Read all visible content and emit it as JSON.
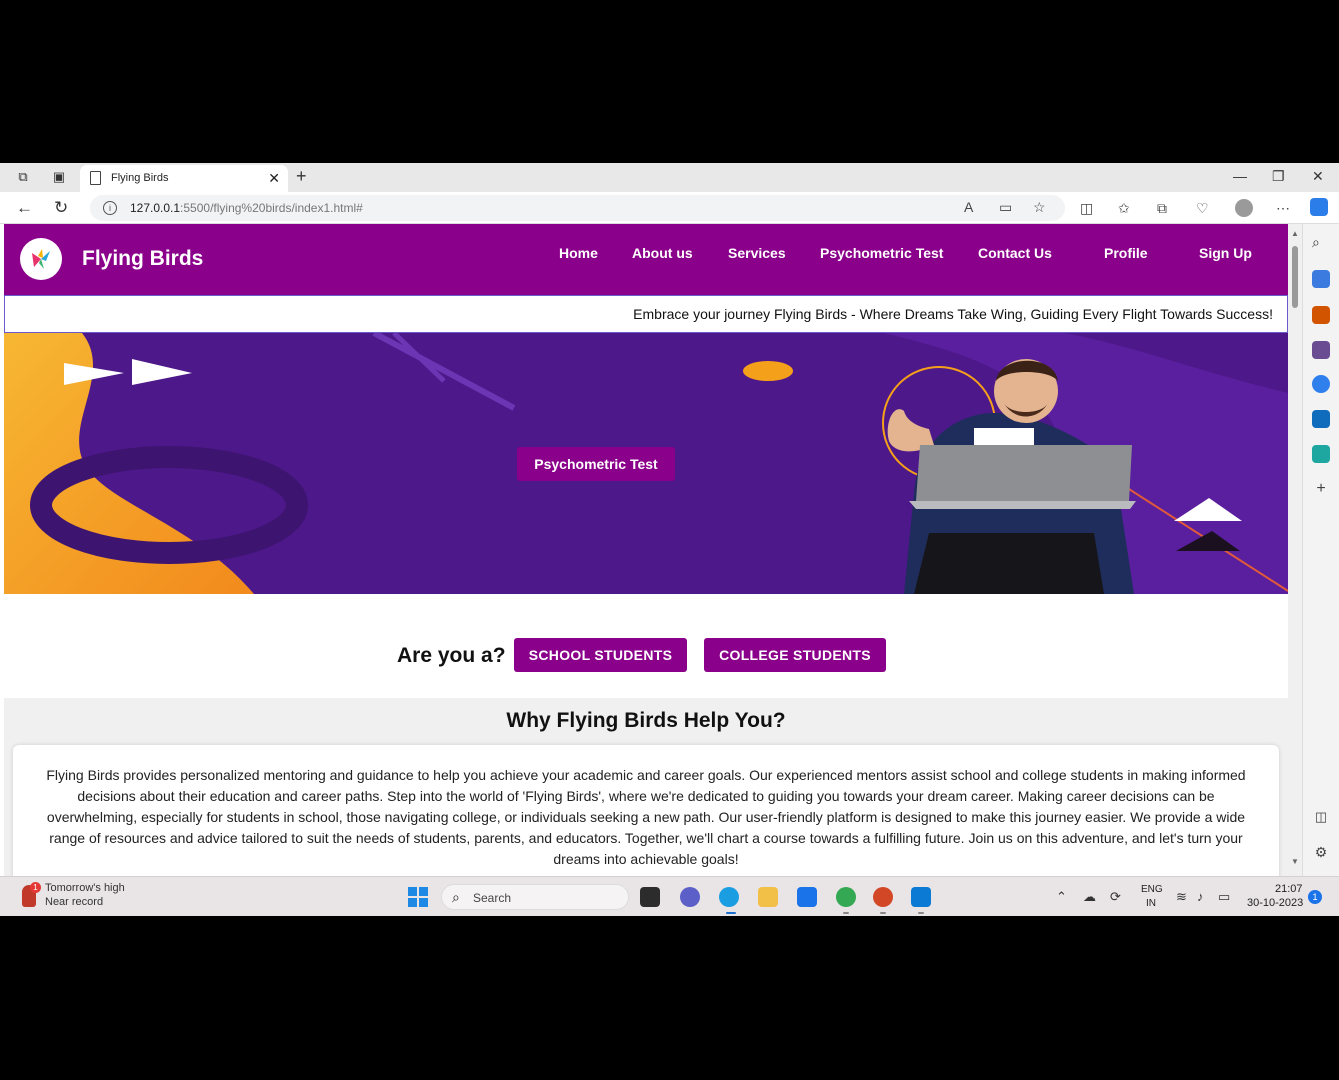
{
  "browser": {
    "tab_title": "Flying Birds",
    "tab_close": "✕",
    "new_tab": "+",
    "url_host": "127.0.0.1",
    "url_rest": ":5500/flying%20birds/index1.html#",
    "win_minimize": "—",
    "win_restore": "❐",
    "win_close": "✕"
  },
  "site": {
    "brand": "Flying Birds",
    "nav": [
      "Home",
      "About us",
      "Services",
      "Psychometric Test",
      "Contact Us",
      "Profile",
      "Sign Up"
    ],
    "marquee": "Embrace your journey Flying Birds - Where Dreams Take Wing, Guiding Every Flight Towards Success!",
    "hero_button": "Psychometric Test",
    "ask_label": "Are you a?",
    "school_button": "SCHOOL STUDENTS",
    "college_button": "COLLEGE STUDENTS",
    "why_title": "Why Flying Birds Help You?",
    "why_text": "Flying Birds provides personalized mentoring and guidance to help you achieve your academic and career goals. Our experienced mentors assist school and college students in making informed decisions about their education and career paths. Step into the world of 'Flying Birds', where we're dedicated to guiding you towards your dream career. Making career decisions can be overwhelming, especially for students in school, those navigating college, or individuals seeking a new path. Our user-friendly platform is designed to make this journey easier. We provide a wide range of resources and advice tailored to suit the needs of students, parents, and educators. Together, we'll chart a course towards a fulfilling future. Join us on this adventure, and let's turn your dreams into achievable goals!"
  },
  "taskbar": {
    "weather_line1": "Tomorrow's high",
    "weather_line2": "Near record",
    "weather_badge": "1",
    "search_label": "Search",
    "lang_line1": "ENG",
    "lang_line2": "IN",
    "time": "21:07",
    "date": "30-10-2023",
    "notification_count": "1"
  },
  "colors": {
    "brand_purple": "#8b008b",
    "hero_purple": "#4d1889",
    "accent_orange": "#f5a01a"
  }
}
